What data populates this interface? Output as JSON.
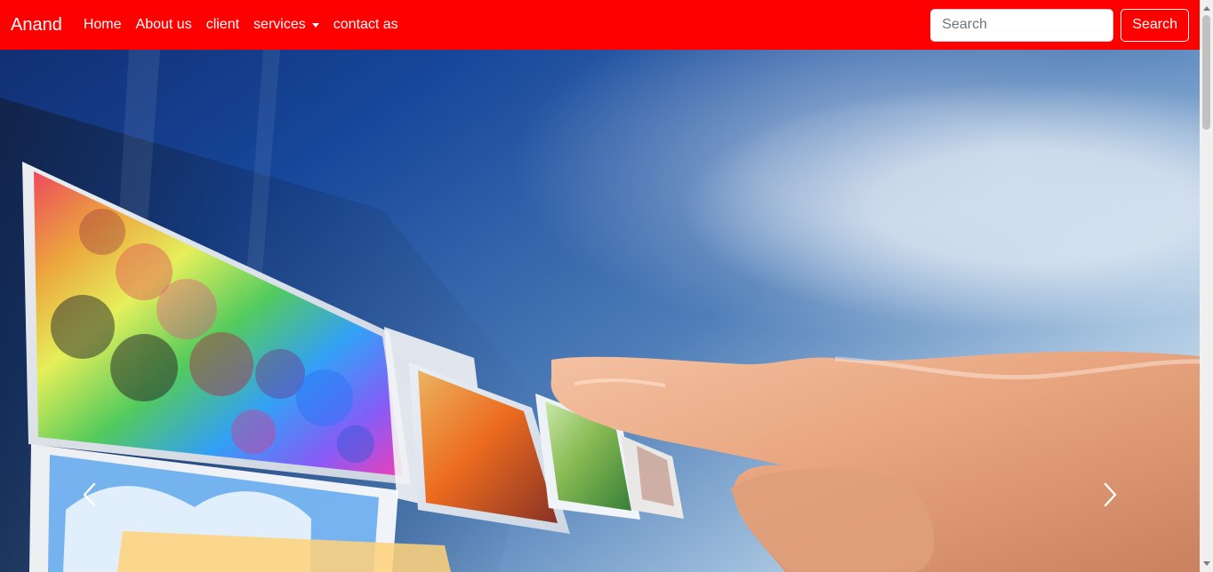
{
  "navbar": {
    "brand": "Anand",
    "links": [
      "Home",
      "About us",
      "client",
      "services",
      "contact as"
    ],
    "search_placeholder": "Search",
    "search_button": "Search"
  },
  "hero": {
    "slide_image": "hand-touching-floating-picture-panels"
  },
  "colors": {
    "navbar": "#ff0000",
    "nav_text": "#ffffff",
    "sky_dark": "#16479b",
    "sky_light": "#eef3f7"
  },
  "icons": {
    "previous": "chevron-left-icon",
    "next": "chevron-right-icon",
    "dropdown": "caret-down-icon"
  }
}
